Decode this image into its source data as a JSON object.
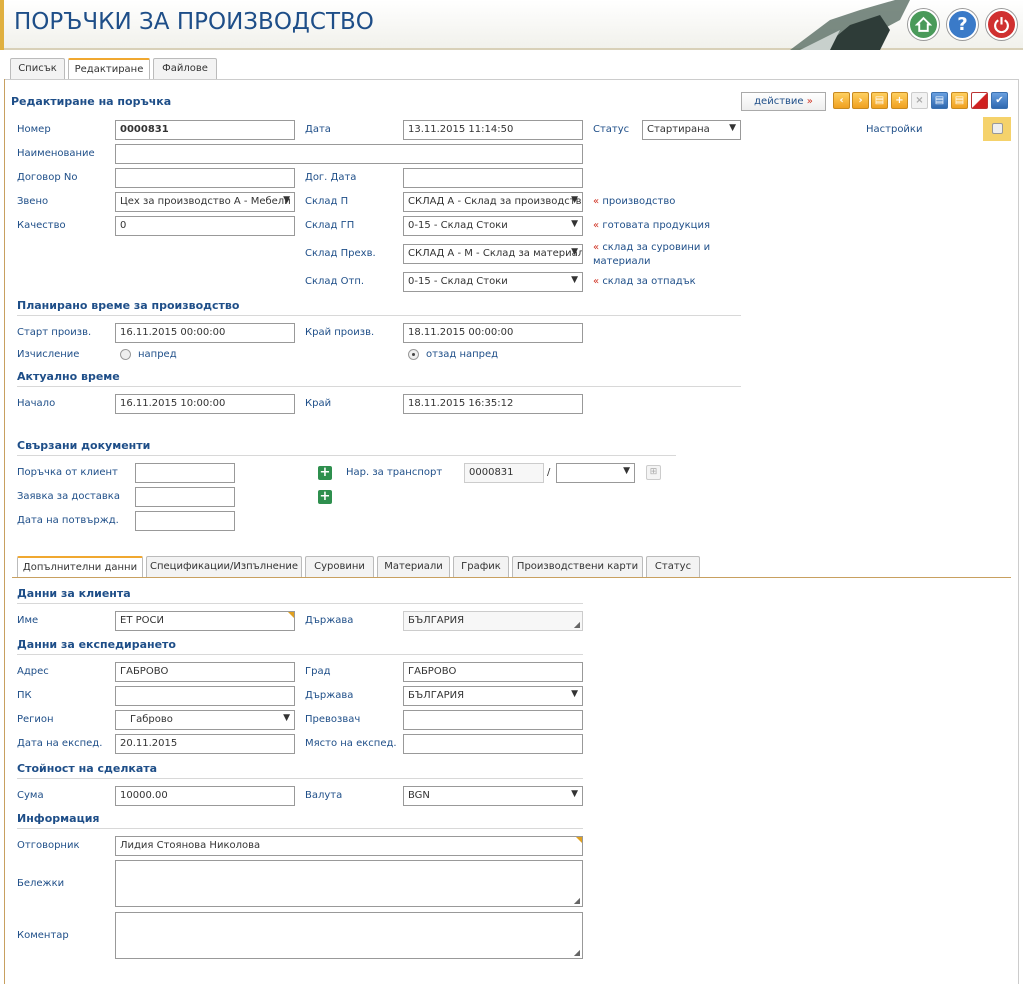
{
  "header": {
    "title": "ПОРЪЧКИ ЗА ПРОИЗВОДСТВО",
    "home_icon": "home-icon",
    "help_icon": "?",
    "power_icon": "power-icon",
    "colors": {
      "home": "#4a9a5a",
      "help": "#3a7ac8",
      "power": "#d03030"
    }
  },
  "top_tabs": [
    "Списък",
    "Редактиране",
    "Файлове"
  ],
  "form": {
    "heading": "Редактиране на поръчка",
    "action_label": "действие",
    "action_arrow": "»",
    "settings_label": "Настройки",
    "number_label": "Номер",
    "number": "0000831",
    "date_label": "Дата",
    "date": "13.11.2015 11:14:50",
    "status_label": "Статус",
    "status": "Стартирана",
    "name_label": "Наименование",
    "name": "",
    "contract_label": "Договор No",
    "contract": "",
    "contract_date_label": "Дог. Дата",
    "contract_date": "",
    "unit_label": "Звено",
    "unit": "Цех за производство А - Мебели",
    "wh_p_label": "Склад П",
    "wh_p": "СКЛАД А - Склад за производство",
    "wh_p_note": "производство",
    "quality_label": "Качество",
    "quality": "0",
    "wh_gp_label": "Склад ГП",
    "wh_gp": "0-15 - Склад Стоки",
    "wh_gp_note": "готовата продукция",
    "wh_transfer_label": "Склад Прехв.",
    "wh_transfer": "СКЛАД А - М - Склад за материали",
    "wh_transfer_note": "склад за суровини и материали",
    "wh_waste_label": "Склад Отп.",
    "wh_waste": "0-15 - Склад Стоки",
    "wh_waste_note": "склад за отпадък",
    "note_marker": "«"
  },
  "planned": {
    "heading": "Планирано време за производство",
    "start_label": "Старт произв.",
    "start": "16.11.2015 00:00:00",
    "end_label": "Край произв.",
    "end": "18.11.2015 00:00:00",
    "calc_label": "Изчисление",
    "forward": "напред",
    "backward": "отзад напред"
  },
  "actual": {
    "heading": "Актуално време",
    "begin_label": "Начало",
    "begin": "16.11.2015 10:00:00",
    "end_label": "Край",
    "end": "18.11.2015 16:35:12"
  },
  "related": {
    "heading": "Свързани документи",
    "client_order_label": "Поръчка от клиент",
    "client_order": "",
    "delivery_request_label": "Заявка за доставка",
    "delivery_request": "",
    "confirm_date_label": "Дата на потвържд.",
    "confirm_date": "",
    "transport_label": "Нар. за транспорт",
    "transport_no": "0000831",
    "transport_sep": "/",
    "transport_sel": ""
  },
  "bottom_tabs": [
    "Допълнителни данни",
    "Спецификации/Изпълнение",
    "Суровини",
    "Материали",
    "График",
    "Производствени карти",
    "Статус"
  ],
  "client": {
    "heading": "Данни за клиента",
    "name_label": "Име",
    "name": "ЕТ РОСИ",
    "country_label": "Държава",
    "country": "БЪЛГАРИЯ"
  },
  "shipping": {
    "heading": "Данни за експедирането",
    "address_label": "Адрес",
    "address": "ГАБРОВО",
    "city_label": "Град",
    "city": "ГАБРОВО",
    "zip_label": "ПК",
    "zip": "",
    "country_label": "Държава",
    "country": "БЪЛГАРИЯ",
    "region_label": "Регион",
    "region": "Габрово",
    "carrier_label": "Превозвач",
    "carrier": "",
    "date_label": "Дата на експед.",
    "date": "20.11.2015",
    "place_label": "Място на експед.",
    "place": ""
  },
  "deal": {
    "heading": "Стойност на сделката",
    "sum_label": "Сума",
    "sum": "10000.00",
    "currency_label": "Валута",
    "currency": "BGN"
  },
  "info": {
    "heading": "Информация",
    "owner_label": "Отговорник",
    "owner": "Лидия Стоянова Николова",
    "notes_label": "Бележки",
    "notes": "",
    "comment_label": "Коментар",
    "comment": ""
  }
}
